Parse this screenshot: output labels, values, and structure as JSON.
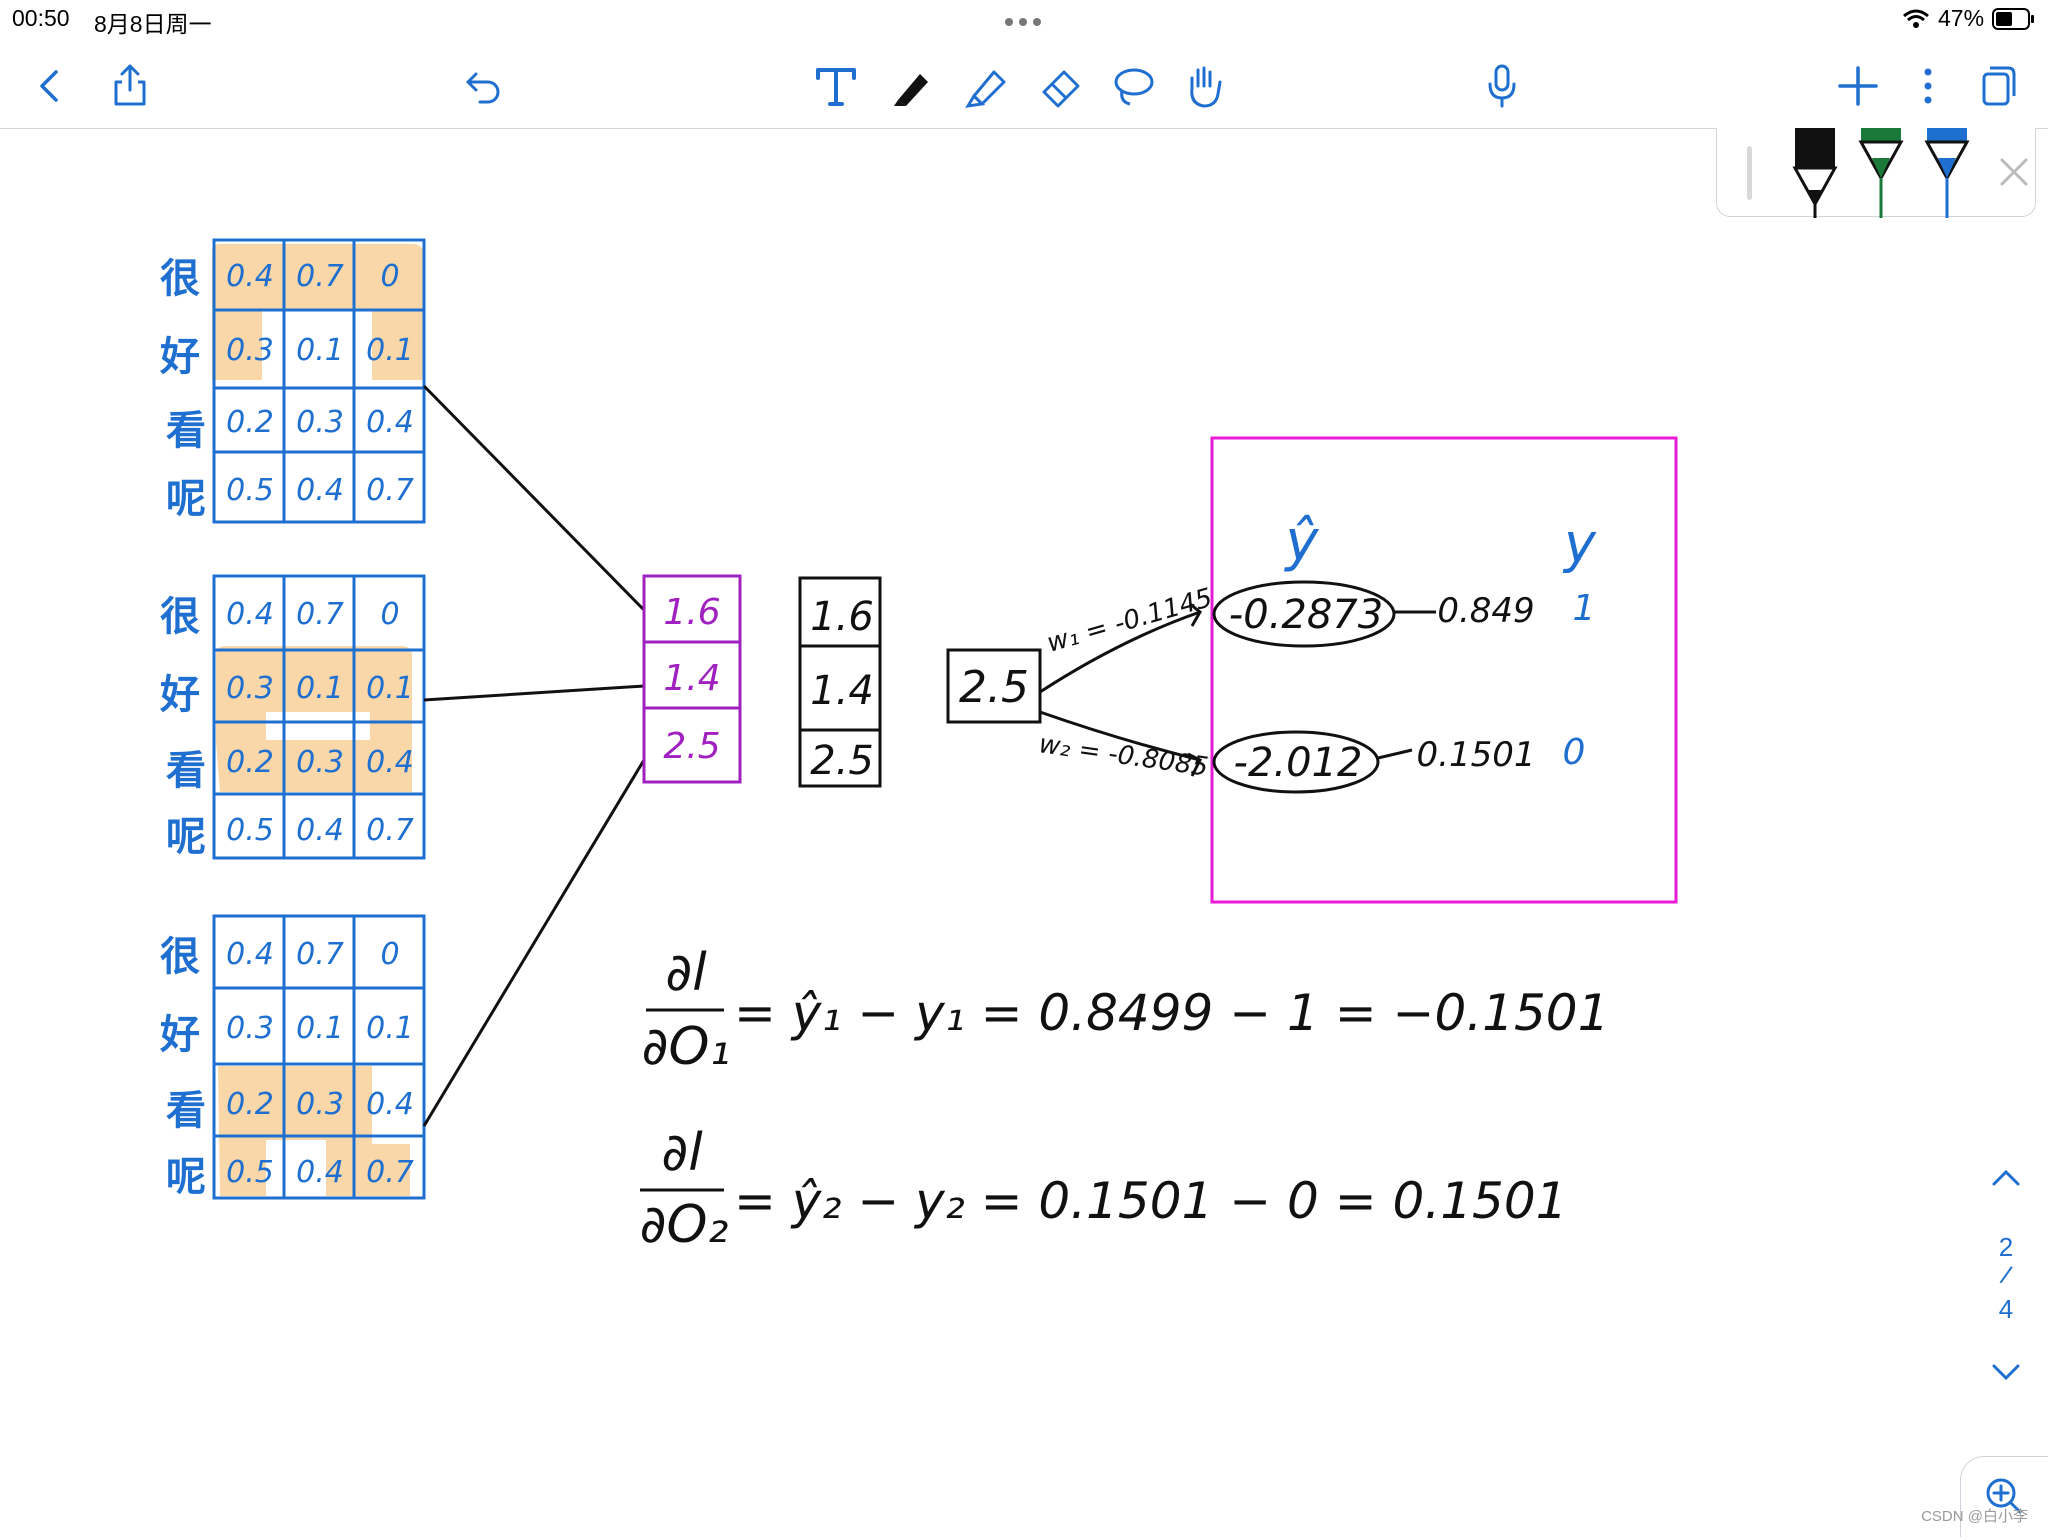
{
  "status_bar": {
    "time": "00:50",
    "date": "8月8日周一",
    "battery": "47%"
  },
  "toolbar": {
    "left_icons": [
      "chevron-left-icon",
      "share-icon",
      "undo-icon"
    ],
    "center_tools": [
      "text-tool-icon",
      "pen-tool-icon",
      "highlighter-icon",
      "eraser-icon",
      "lasso-icon",
      "hand-icon"
    ],
    "right_icons": [
      "microphone-icon",
      "add-icon",
      "more-icon",
      "pages-icon"
    ]
  },
  "pen_tray": {
    "pens": [
      {
        "name": "black-pen",
        "color": "#111111"
      },
      {
        "name": "green-pen",
        "color": "#1b7a3a"
      },
      {
        "name": "blue-pen",
        "color": "#1f6fd0"
      }
    ]
  },
  "page_nav": {
    "current": "2",
    "separator": "/",
    "total": "4"
  },
  "watermark": "CSDN @白小李",
  "note": {
    "row_labels": [
      "很",
      "好",
      "看",
      "呢"
    ],
    "embedding_matrix": [
      [
        "0.4",
        "0.7",
        "0"
      ],
      [
        "0.3",
        "0.1",
        "0.1"
      ],
      [
        "0.2",
        "0.3",
        "0.4"
      ],
      [
        "0.5",
        "0.4",
        "0.7"
      ]
    ],
    "conv_outputs_purple": [
      "1.6",
      "1.4",
      "2.5"
    ],
    "conv_outputs_black": [
      "1.6",
      "1.4",
      "2.5"
    ],
    "pooled": "2.5",
    "w1": "w₁ = -0.1145",
    "w2": "w₂ = -0.8085",
    "o1": "-0.2873",
    "o2": "-2.012",
    "yhat_header": "ŷ",
    "y_header": "y",
    "yhat1": "0.849",
    "yhat2": "0.1501",
    "y1": "1",
    "y2": "0",
    "eq1_lhs_num": "∂l",
    "eq1_lhs_den": "∂O₁",
    "eq1_rhs": "= ŷ₁ − y₁ = 0.8499 − 1 = −0.1501",
    "eq2_lhs_num": "∂l",
    "eq2_lhs_den": "∂O₂",
    "eq2_rhs": "= ŷ₂ − y₂ = 0.1501 − 0 = 0.1501"
  },
  "colors": {
    "ink_blue": "#1f6fd0",
    "ink_purple": "#a020c0",
    "highlight": "#f6c27a",
    "frame_magenta": "#e81ad6",
    "ink_black": "#111111"
  }
}
